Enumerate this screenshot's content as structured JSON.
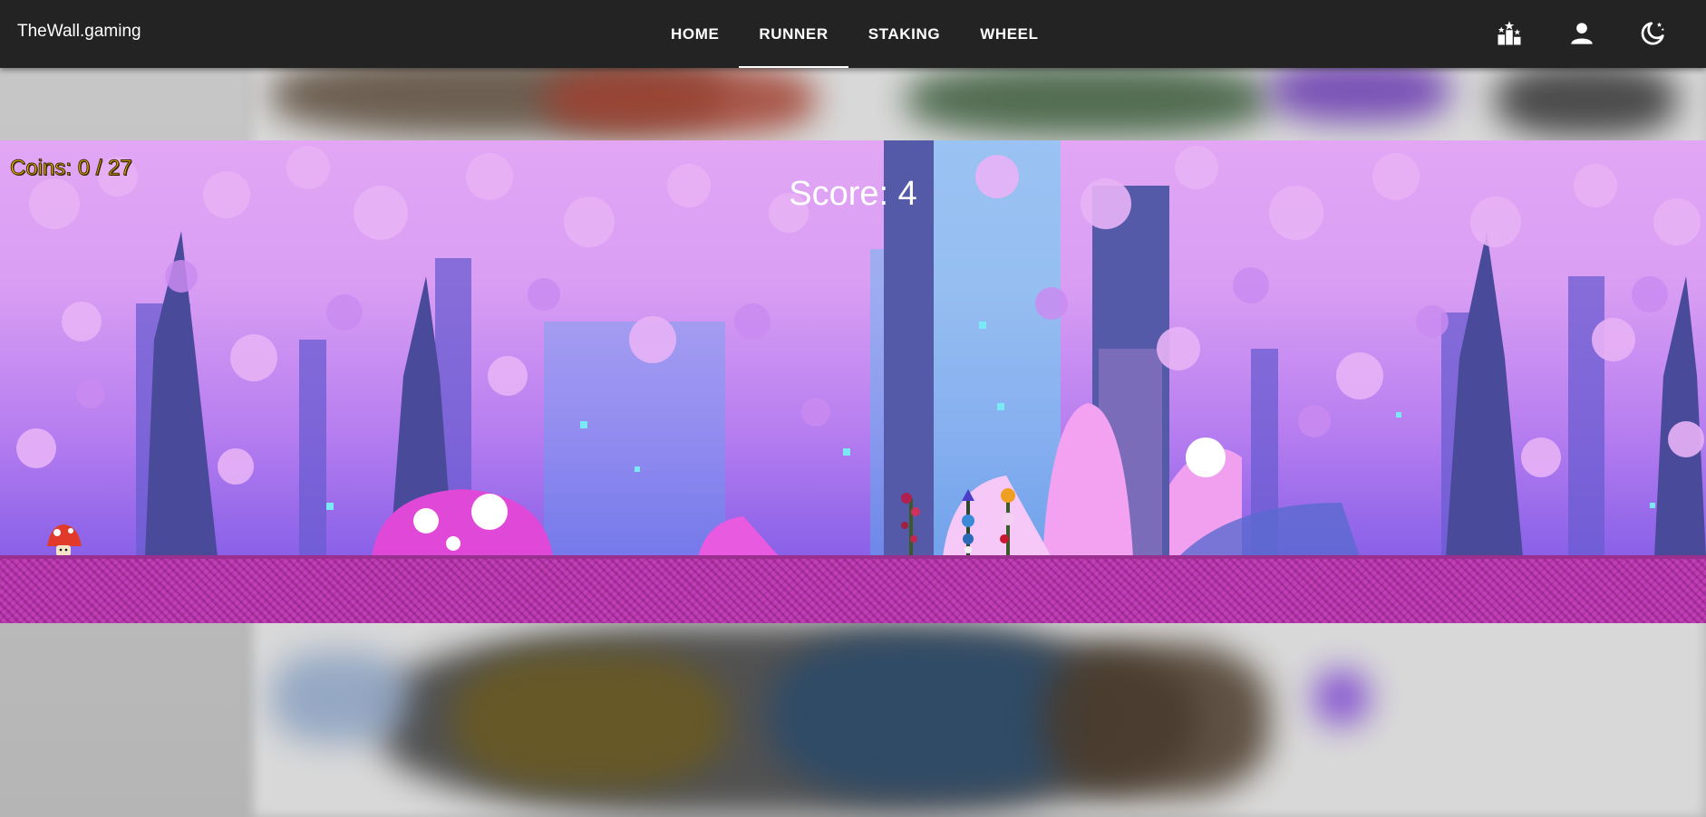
{
  "app": {
    "brand": "TheWall.gaming"
  },
  "nav": {
    "tabs": [
      {
        "label": "HOME",
        "active": false
      },
      {
        "label": "RUNNER",
        "active": true
      },
      {
        "label": "STAKING",
        "active": false
      },
      {
        "label": "WHEEL",
        "active": false
      }
    ],
    "icons": [
      "leaderboard-stars-icon",
      "account-icon",
      "dark-mode-icon"
    ]
  },
  "game": {
    "coins_label": "Coins: 0 / 27",
    "score_label": "Score: 4",
    "player": "mushroom",
    "obstacles": [
      "flower-plant",
      "blue-flower-plant",
      "orange-flower-plant"
    ],
    "colors": {
      "sky": "#d99ef3",
      "ground": "#b83aac",
      "coins_text": "#f2b600",
      "score_text": "#ffffff"
    }
  }
}
